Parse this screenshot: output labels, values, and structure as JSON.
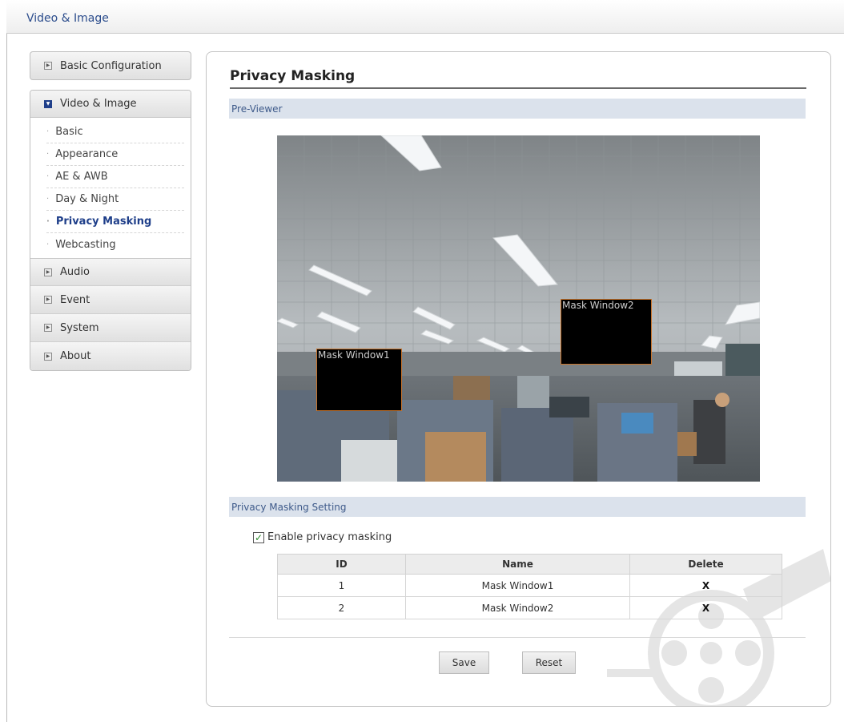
{
  "header": {
    "title": "Video & Image"
  },
  "sidebar": {
    "basic_configuration": "Basic Configuration",
    "video_image": "Video & Image",
    "sub_items": [
      "Basic",
      "Appearance",
      "AE & AWB",
      "Day & Night",
      "Privacy Masking",
      "Webcasting"
    ],
    "active_sub_item": "Privacy Masking",
    "audio": "Audio",
    "event": "Event",
    "system": "System",
    "about": "About"
  },
  "main": {
    "title": "Privacy Masking",
    "preview_section": "Pre-Viewer",
    "masks_on_preview": [
      "Mask Window1",
      "Mask Window2"
    ],
    "setting_section": "Privacy Masking Setting",
    "enable_label": "Enable privacy masking",
    "enable_checked": true,
    "table": {
      "headers": [
        "ID",
        "Name",
        "Delete"
      ],
      "rows": [
        {
          "id": "1",
          "name": "Mask Window1",
          "delete": "X"
        },
        {
          "id": "2",
          "name": "Mask Window2",
          "delete": "X"
        }
      ]
    },
    "save_label": "Save",
    "reset_label": "Reset"
  },
  "colors": {
    "accent": "#1f3f8a",
    "section_bar": "#dbe2ec",
    "mask_border": "#c8732a"
  },
  "icons": {
    "collapsed": "expand-arrow-icon",
    "expanded": "collapse-arrow-icon",
    "checkbox": "checkmark-icon"
  }
}
